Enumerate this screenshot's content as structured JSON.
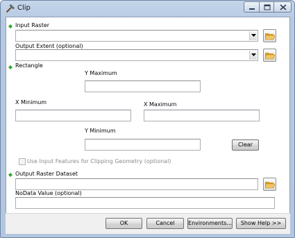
{
  "window": {
    "title": "Clip",
    "icon": "hammer-icon"
  },
  "title_buttons": {
    "minimize_icon": "minimize-icon",
    "maximize_icon": "maximize-icon",
    "close_icon": "close-icon"
  },
  "form": {
    "input_raster": {
      "label": "Input Raster",
      "value": ""
    },
    "output_extent": {
      "label": "Output Extent (optional)",
      "value": ""
    },
    "rectangle": {
      "label": "Rectangle",
      "y_maximum": {
        "label": "Y Maximum",
        "value": ""
      },
      "x_minimum": {
        "label": "X Minimum",
        "value": ""
      },
      "x_maximum": {
        "label": "X Maximum",
        "value": ""
      },
      "y_minimum": {
        "label": "Y Minimum",
        "value": ""
      },
      "clear_label": "Clear"
    },
    "use_input_features": {
      "label": "Use Input Features for Clipping Geometry (optional)",
      "checked": false,
      "enabled": false
    },
    "output_raster": {
      "label": "Output Raster Dataset",
      "value": ""
    },
    "nodata": {
      "label": "NoData Value (optional)",
      "value": ""
    }
  },
  "buttons": {
    "ok": "OK",
    "cancel": "Cancel",
    "environments": "Environments...",
    "show_help": "Show Help >>"
  },
  "colors": {
    "required_marker": "#2fa82f",
    "folder_icon": "#e8b64a"
  }
}
